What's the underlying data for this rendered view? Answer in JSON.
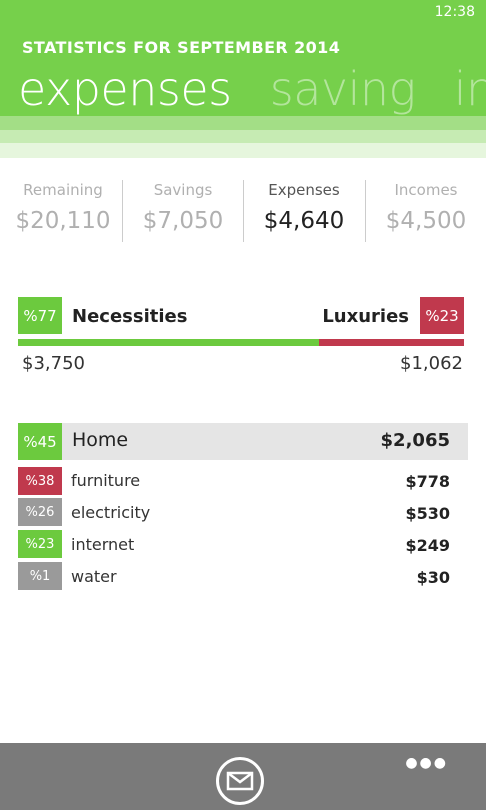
{
  "status_bar": {
    "time": "12:38"
  },
  "header": {
    "title": "STATISTICS FOR SEPTEMBER 2014",
    "pivot": [
      "expenses",
      "saving",
      "inco"
    ]
  },
  "summary": [
    {
      "label": "Remaining",
      "value": "$20,110"
    },
    {
      "label": "Savings",
      "value": "$7,050"
    },
    {
      "label": "Expenses",
      "value": "$4,640"
    },
    {
      "label": "Incomes",
      "value": "$4,500"
    }
  ],
  "split": {
    "left_pct": "%77",
    "left_label": "Necessities",
    "left_amount": "$3,750",
    "right_pct": "%23",
    "right_label": "Luxuries",
    "right_amount": "$1,062",
    "necessities_fraction": 0.67
  },
  "category": {
    "pct": "%45",
    "name": "Home",
    "total": "$2,065",
    "items": [
      {
        "pct": "%38",
        "name": "furniture",
        "amount": "$778",
        "color": "#c0394d"
      },
      {
        "pct": "%26",
        "name": "electricity",
        "amount": "$530",
        "color": "#9a9a9a"
      },
      {
        "pct": "%23",
        "name": "internet",
        "amount": "$249",
        "color": "#6cca3e"
      },
      {
        "pct": "%1",
        "name": "water",
        "amount": "$30",
        "color": "#9a9a9a"
      }
    ]
  },
  "colors": {
    "accent": "#76d04b",
    "green": "#6cca3e",
    "red": "#c0394d",
    "gray": "#9a9a9a",
    "appbar": "#7a7a7a"
  },
  "appbar": {
    "icons": [
      "mail-icon",
      "more-icon"
    ]
  }
}
